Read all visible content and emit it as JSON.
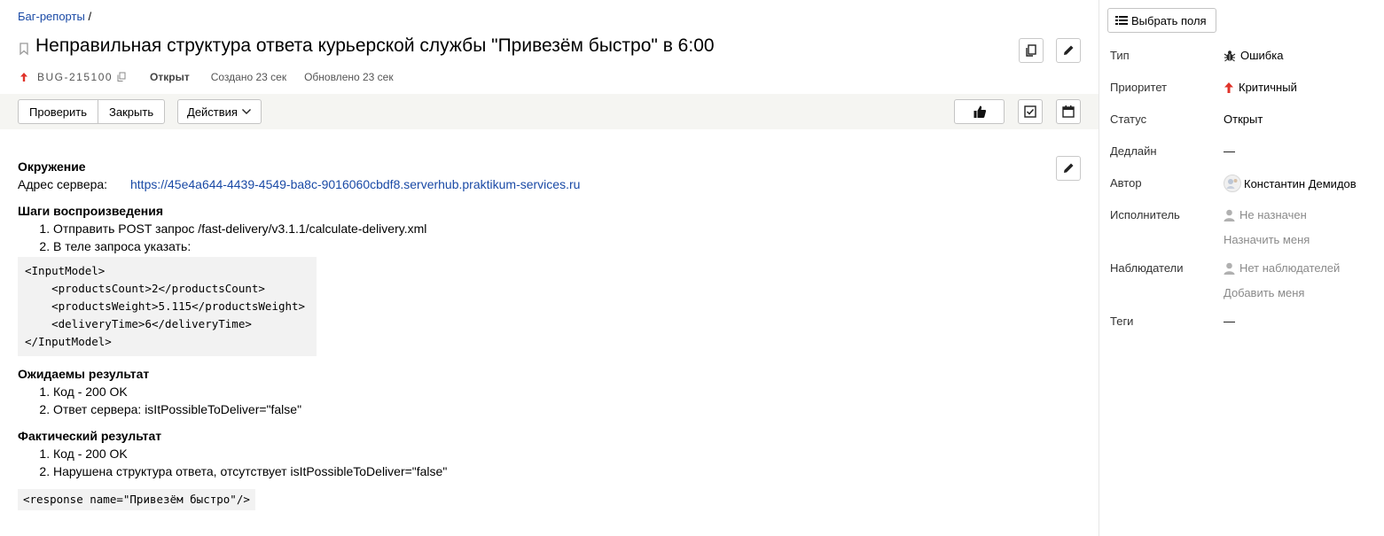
{
  "breadcrumb": {
    "link": "Баг-репорты",
    "separator": "/"
  },
  "issue": {
    "title": "Неправильная структура ответа курьерской службы \"Привезём быстро\" в 6:00",
    "key": "BUG-215100",
    "status": "Открыт",
    "created": "Создано 23 сек",
    "updated": "Обновлено 23 сек"
  },
  "toolbar": {
    "check_label": "Проверить",
    "close_label": "Закрыть",
    "actions_label": "Действия"
  },
  "description": {
    "env_heading": "Окружение",
    "server_label": "Адрес сервера:",
    "server_url": "https://45e4a644-4439-4549-ba8c-9016060cbdf8.serverhub.praktikum-services.ru",
    "steps_heading": "Шаги воспроизведения",
    "steps": [
      "Отправить POST запрос /fast-delivery/v3.1.1/calculate-delivery.xml",
      "В теле запроса указать:"
    ],
    "request_code": [
      "<InputModel>",
      "    <productsCount>2</productsCount>",
      "    <productsWeight>5.115</productsWeight>",
      "    <deliveryTime>6</deliveryTime>",
      "</InputModel>"
    ],
    "expected_heading": "Ожидаемы результат",
    "expected": [
      "Код - 200 OK",
      "Ответ сервера: isItPossibleToDeliver=\"false\""
    ],
    "actual_heading": "Фактический результат",
    "actual": [
      "Код - 200 OK",
      "Нарушена структура ответа, отсутствует isItPossibleToDeliver=\"false\""
    ],
    "response_code": "<response name=\"Привезём быстро\"/>"
  },
  "sidebar": {
    "select_fields_label": "Выбрать поля",
    "props": {
      "type": {
        "label": "Тип",
        "value": "Ошибка"
      },
      "priority": {
        "label": "Приоритет",
        "value": "Критичный"
      },
      "status": {
        "label": "Статус",
        "value": "Открыт"
      },
      "deadline": {
        "label": "Дедлайн",
        "value": "—"
      },
      "author": {
        "label": "Автор",
        "value": "Константин Демидов"
      },
      "assignee": {
        "label": "Исполнитель",
        "value": "Не назначен",
        "action": "Назначить меня"
      },
      "watchers": {
        "label": "Наблюдатели",
        "value": "Нет наблюдателей",
        "action": "Добавить меня"
      },
      "tags": {
        "label": "Теги",
        "value": "—"
      }
    }
  },
  "colors": {
    "link": "#1a4aa6",
    "priority_critical": "#e0332a",
    "toolbar_bg": "#f5f5f2",
    "code_bg": "#f2f2f2"
  },
  "icons": [
    "bookmark-icon",
    "copy-icon",
    "edit-icon",
    "priority-arrow-icon",
    "chevron-down-icon",
    "thumbs-up-icon",
    "checklist-icon",
    "calendar-icon",
    "fields-icon",
    "bug-icon",
    "user-icon",
    "avatar"
  ]
}
